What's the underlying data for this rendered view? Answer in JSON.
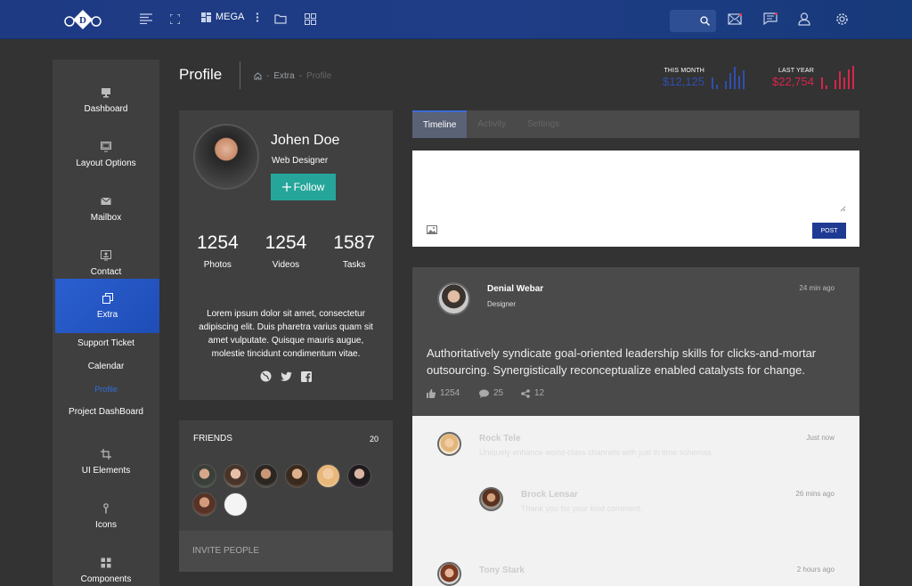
{
  "topbar": {
    "logo_letter": "D",
    "mega_label": "MEGA",
    "icons": [
      "menu-lines-icon",
      "fullscreen-icon",
      "mega-grid-icon",
      "more-vertical-icon",
      "folder-icon",
      "grid-icon",
      "search-icon",
      "mail-icon",
      "chat-icon",
      "user-icon",
      "settings-icon"
    ]
  },
  "sidebar": {
    "items": [
      {
        "label": "Dashboard",
        "icon": "monitor-icon"
      },
      {
        "label": "Layout Options",
        "icon": "layout-icon"
      },
      {
        "label": "Mailbox",
        "icon": "envelope-icon"
      },
      {
        "label": "Contact",
        "icon": "contact-icon"
      },
      {
        "label": "Extra",
        "icon": "copy-icon"
      }
    ],
    "submenu": [
      "Support Ticket",
      "Calendar",
      "Profile",
      "Project DashBoard"
    ],
    "items_bottom": [
      {
        "label": "UI Elements",
        "icon": "crop-icon"
      },
      {
        "label": "Icons",
        "icon": "pin-icon"
      },
      {
        "label": "Components",
        "icon": "components-icon"
      }
    ],
    "active_submenu": "Profile"
  },
  "header": {
    "title": "Profile",
    "breadcrumb": [
      "Extra",
      "Profile"
    ],
    "this_month_label": "THIS MONTH",
    "this_month_value": "$12,125",
    "last_year_label": "LAST YEAR",
    "last_year_value": "$22,754",
    "colors": {
      "month": "#2f4fb0",
      "year": "#d9254a"
    }
  },
  "profile": {
    "name": "Johen Doe",
    "role": "Web Designer",
    "follow_label": "Follow",
    "stats": [
      {
        "value": "1254",
        "label": "Photos"
      },
      {
        "value": "1254",
        "label": "Videos"
      },
      {
        "value": "1587",
        "label": "Tasks"
      }
    ],
    "bio": "Lorem ipsum dolor sit amet, consectetur adipiscing elit. Duis pharetra varius quam sit amet vulputate. Quisque mauris augue, molestie tincidunt condimentum vitae.",
    "social": [
      "globe-icon",
      "twitter-icon",
      "facebook-icon"
    ]
  },
  "friends": {
    "title": "FRIENDS",
    "count": "20",
    "invite_label": "INVITE PEOPLE"
  },
  "tabs": [
    "Timeline",
    "Activity",
    "Settings"
  ],
  "composer": {
    "post_label": "POST"
  },
  "post": {
    "author": "Denial Webar",
    "role": "Designer",
    "time": "24 min ago",
    "text": "Authoritatively syndicate goal-oriented leadership skills for clicks-and-mortar outsourcing. Synergistically reconceptualize enabled catalysts for change.",
    "likes": "1254",
    "comments": "25",
    "shares": "12"
  },
  "comments": [
    {
      "name": "Rock Tele",
      "time": "Just now",
      "text": "Uniquely enhance world-class channels with just in time schemas."
    },
    {
      "name": "Brock Lensar",
      "time": "26 mins ago",
      "text": "Thank you for your kind comment."
    },
    {
      "name": "Tony Stark",
      "time": "2 hours ago",
      "text": ""
    }
  ]
}
